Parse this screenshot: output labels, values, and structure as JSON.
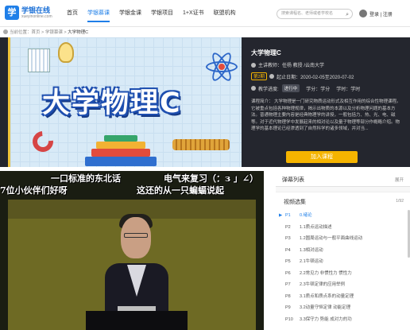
{
  "logo": {
    "name": "学银在线",
    "sub": "xueyinonline.com"
  },
  "nav": [
    "首页",
    "学银慕课",
    "学银金课",
    "学银项目",
    "1+X证书",
    "联盟机构"
  ],
  "nav_active": 1,
  "search": {
    "placeholder": "搜索课程名、老师或者学校名",
    "icon": "search-icon"
  },
  "login": {
    "label": "登录 | 注册"
  },
  "breadcrumb": {
    "prefix": "当前位置：",
    "home": "首页",
    "sep": " > ",
    "section": "学银慕课",
    "current": "大学物理C"
  },
  "banner": {
    "title": "大学物理C"
  },
  "course": {
    "title": "大学物理C",
    "teacher": "主讲教师：任杨 教授 /云南大学",
    "session": "第2期",
    "period": "起止日期：2020-02-05至2020-07-02",
    "progress_label": "教学进度:",
    "tag": "进行中",
    "credit": "学分：学分",
    "hours": "学时：学时",
    "desc": "课程简介：   大学物理是一门研究物质运动形式及相互作用的综合性物理课程。它被重点包括各种物理规律，揭示出物质的本源以及分析物理问题的基本方法。普通物理主要内容是经典物理学的讲授，一般包括力、热、光、电、磁等。对于近代物理学中发展起来的相对论以及量子物理等部分作概略介绍。物理学的基本理论已经渗透到了自然科学的诸多领域，并对当...",
    "enroll": "加入课程"
  },
  "danmaku": [
    "一口标准的东北话",
    "电气来复习（：з 」∠）",
    "7位小伙伴们好呀",
    "这还的从一只蝙蝠说起"
  ],
  "side": {
    "danmu_title": "弹幕列表",
    "danmu_expand": "展开",
    "playlist_title": "视频选集",
    "playlist_count": "1/92",
    "items": [
      {
        "pn": "P1",
        "title": "0.绪论",
        "active": true
      },
      {
        "pn": "P2",
        "title": "1.1质点运动描述"
      },
      {
        "pn": "P3",
        "title": "1.2圆周运动与一般平面曲线运动"
      },
      {
        "pn": "P4",
        "title": "1.3相对运动"
      },
      {
        "pn": "P5",
        "title": "2.1牛顿运动"
      },
      {
        "pn": "P6",
        "title": "2.2常见力 非惯性力 惯性力"
      },
      {
        "pn": "P7",
        "title": "2.3牛顿定律的应用举例"
      },
      {
        "pn": "P8",
        "title": "3.1质点和质点系的动量定理"
      },
      {
        "pn": "P9",
        "title": "3.2动量守恒定律 动能定理"
      },
      {
        "pn": "P10",
        "title": "3.3保守力 势能 成对力的功"
      }
    ]
  }
}
